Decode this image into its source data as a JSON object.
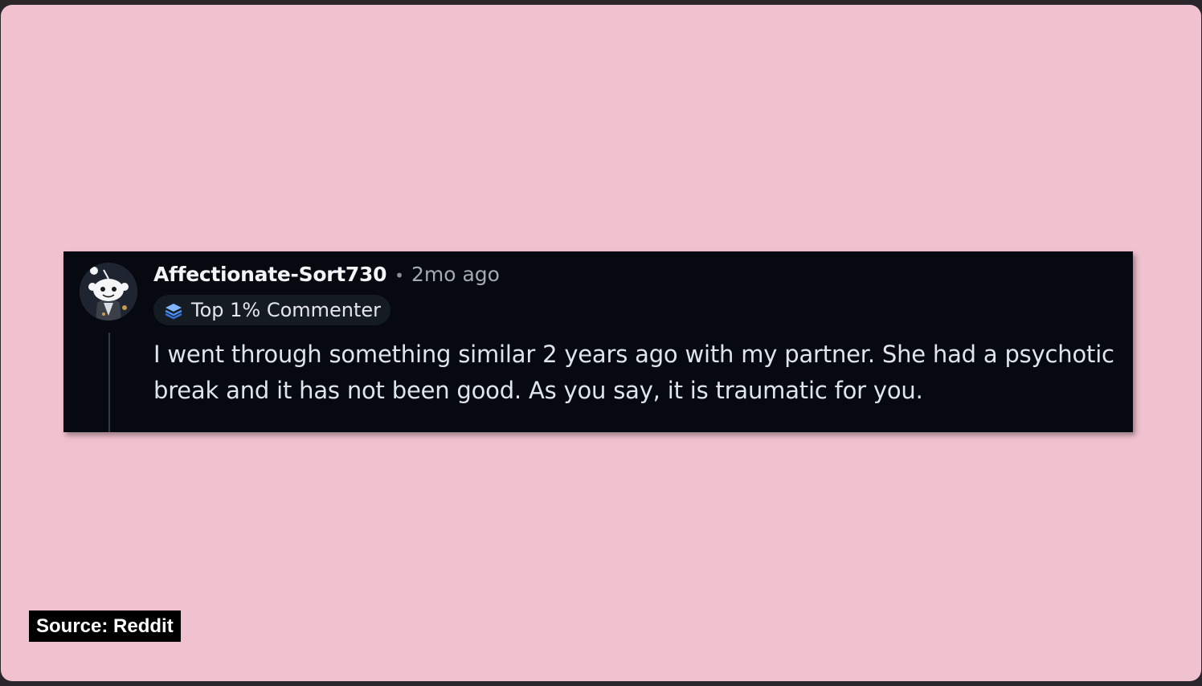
{
  "comment": {
    "username": "Affectionate-Sort730",
    "separator": "•",
    "timestamp": "2mo ago",
    "flair": {
      "icon": "commenter-badge-icon",
      "label": "Top 1% Commenter"
    },
    "body": "I went through something similar 2 years ago with my partner. She had a psychotic break and it has not been good. As you say, it is traumatic for you."
  },
  "source": {
    "label": "Source: Reddit"
  },
  "colors": {
    "background": "#f0c1cf",
    "card": "#060a10",
    "username": "#f2f4f6",
    "timestamp": "#a3aab3",
    "body": "#dfe5ed",
    "flair_bg": "#151b23"
  }
}
